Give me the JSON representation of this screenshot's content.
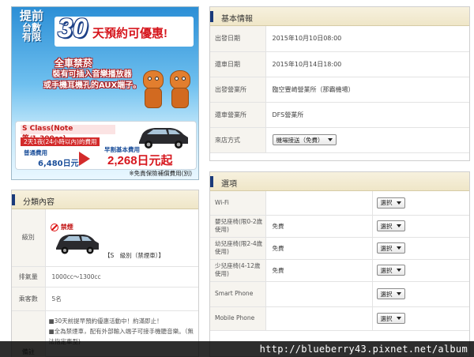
{
  "banner": {
    "prefix_line1": "提前",
    "prefix_line2": "台數",
    "prefix_line3": "有限",
    "days": "30",
    "headline": "天預約可優惠!",
    "sub_title": "全車禁菸",
    "sub_line1": "裝有可插入音樂播放器",
    "sub_line2": "或手機耳機孔的AUX端子。",
    "car_class": "S Class(Note等/1,300cc)",
    "plan_text": "2天1夜(24小時以內)的費用",
    "normal_label": "普通費用",
    "normal_price": "6,480日元",
    "early_label": "早割基本費用",
    "early_price": "2,268日元起",
    "note": "※免責保險補償費用(別)"
  },
  "category": {
    "title": "分類內容",
    "rows": {
      "class_label": "級別",
      "no_smoking_badge": "禁煙",
      "class_value": "【S　級別（禁煙車）】",
      "displacement_label": "排氣量",
      "displacement_value": "1000cc～1300cc",
      "capacity_label": "乘客數",
      "capacity_value": "5名",
      "notes_label": "備註",
      "notes": [
        "■30天前提早預約優惠活動中！約滿即止！",
        "■全為禁煙車，配有外部輸入端子可接手機聽音樂。（無",
        "法指定車型)"
      ]
    }
  },
  "basic_info": {
    "title": "基本情報",
    "rows": [
      {
        "label": "出發日期",
        "value": "2015年10月10日08:00"
      },
      {
        "label": "還車日期",
        "value": "2015年10月14日18:00"
      },
      {
        "label": "出發營業所",
        "value": "臨空豐崎營業所（那霸機場）"
      },
      {
        "label": "還車營業所",
        "value": "DFS營業所"
      }
    ],
    "method_label": "來店方式",
    "method_value": "機場接送（免費）"
  },
  "options": {
    "title": "選項",
    "rows": [
      {
        "label": "Wi-Fi",
        "price": "",
        "select": "選択"
      },
      {
        "label": "嬰兒座椅(限0-2歲使用)",
        "price": "免費",
        "select": "選択"
      },
      {
        "label": "幼兒座椅(限2-4歲使用)",
        "price": "免費",
        "select": "選択"
      },
      {
        "label": "少兒座椅(4-12歲使用)",
        "price": "免費",
        "select": "選択"
      },
      {
        "label": "Smart Phone",
        "price": "",
        "select": "選択"
      },
      {
        "label": "Mobile Phone",
        "price": "",
        "select": "選択"
      }
    ]
  },
  "watermark": "http://blueberry43.pixnet.net/album",
  "colors": {
    "section_bar": "#1a3a7a",
    "accent_red": "#d6161d",
    "banner_blue": "#2c8fd6"
  }
}
